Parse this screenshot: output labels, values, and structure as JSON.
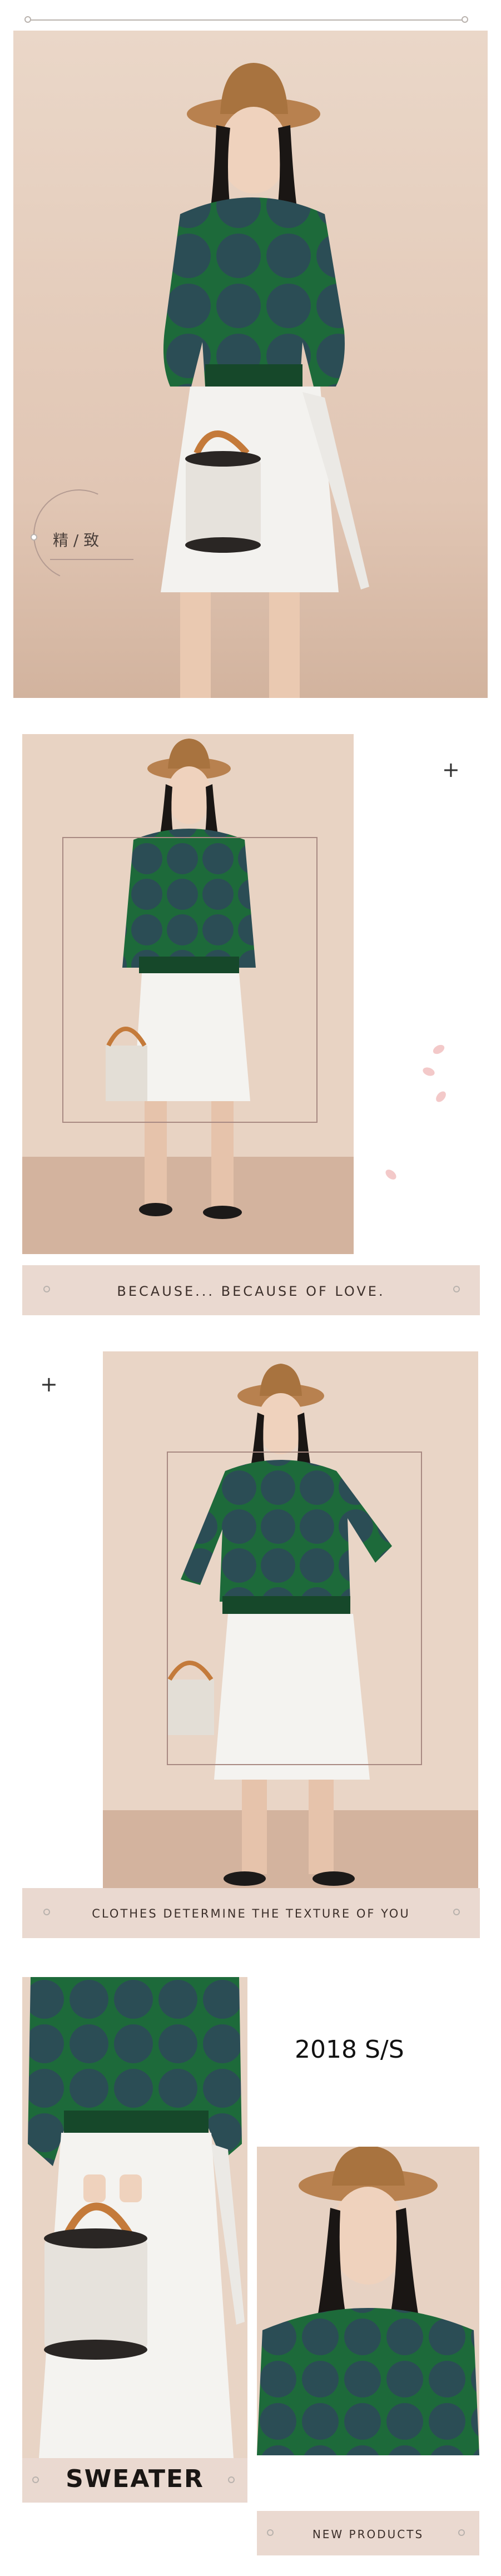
{
  "section1": {
    "badge_text": "精 / 致"
  },
  "section2": {
    "banner_text": "BECAUSE... BECAUSE OF LOVE."
  },
  "section3": {
    "banner_text": "CLOTHES DETERMINE THE TEXTURE OF YOU"
  },
  "section4": {
    "year_text": "2018 S/S",
    "sweater_text": "SWEATER",
    "new_products_text": "NEW PRODUCTS"
  },
  "plus_sign": "+",
  "colors": {
    "sweater_green": "#1f5a35",
    "polka": "#2a4f4e",
    "skirt": "#f2f1ee",
    "hat": "#b07c4a",
    "banner": "#ead9d0",
    "frame": "#a88982"
  }
}
